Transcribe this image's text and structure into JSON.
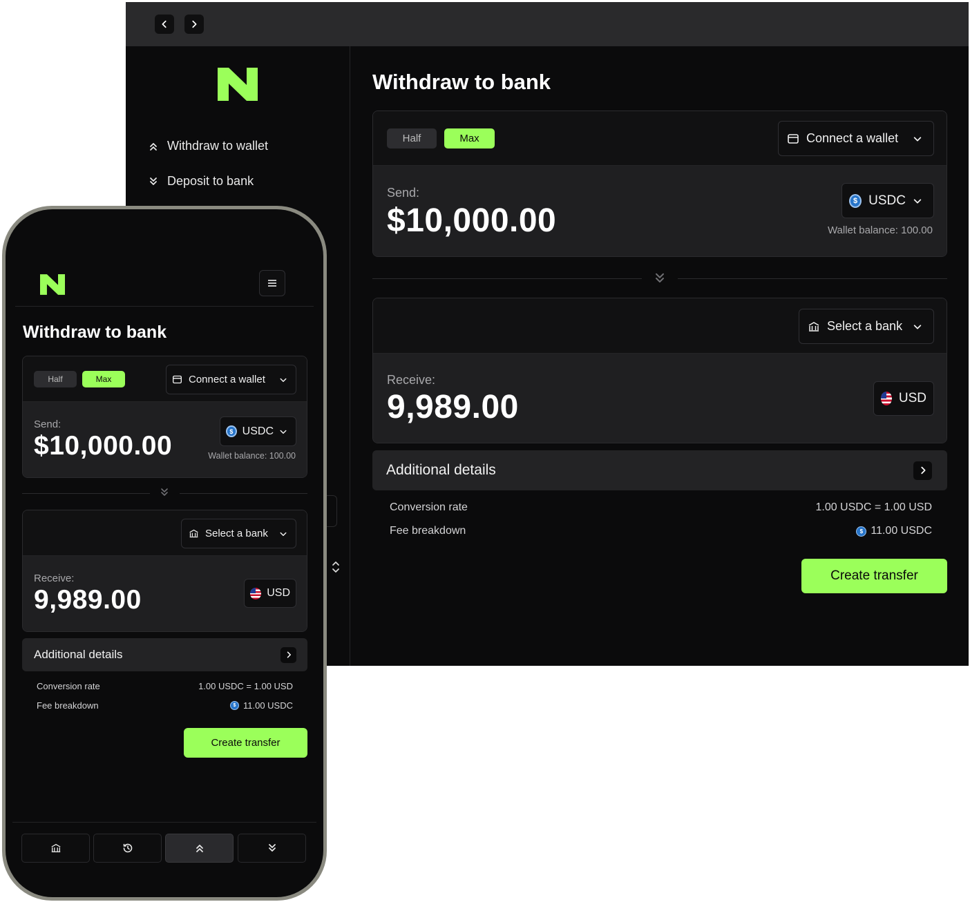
{
  "app": {
    "page_title": "Withdraw to bank"
  },
  "sidebar": {
    "items": [
      {
        "label": "Withdraw to wallet",
        "icon": "chevrons-up-icon"
      },
      {
        "label": "Deposit to bank",
        "icon": "chevrons-down-icon"
      }
    ]
  },
  "send": {
    "half_label": "Half",
    "max_label": "Max",
    "wallet_dropdown": "Connect a wallet",
    "label": "Send:",
    "amount": "$10,000.00",
    "currency": "USDC",
    "balance": "Wallet balance: 100.00"
  },
  "receive": {
    "bank_dropdown": "Select a bank",
    "label": "Receive:",
    "amount": "9,989.00",
    "currency": "USD"
  },
  "details": {
    "title": "Additional details",
    "rows": [
      {
        "label": "Conversion rate",
        "value": "1.00 USDC = 1.00 USD"
      },
      {
        "label": "Fee breakdown",
        "value": "11.00 USDC"
      }
    ]
  },
  "cta": {
    "label": "Create transfer"
  },
  "icons": {
    "coin": "$"
  },
  "colors": {
    "accent": "#9bff5a",
    "background": "#0b0b0c",
    "surface": "#1f1f21"
  }
}
